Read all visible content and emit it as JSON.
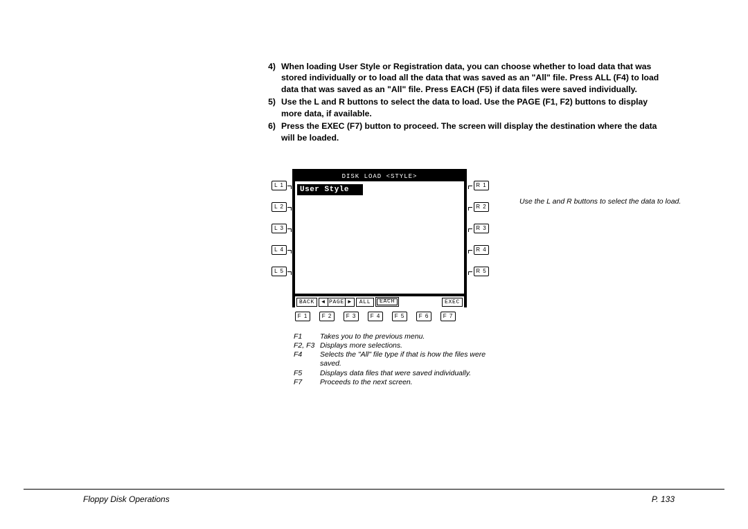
{
  "steps": [
    {
      "n": "4)",
      "text": "When loading User Style or Registration data, you can choose whether to load data that was stored individually or to load all the data that was saved as an \"All\" file.  Press ALL (F4) to load data that was saved as an \"All\" file.  Press EACH (F5) if data files were saved individually."
    },
    {
      "n": "5)",
      "text": "Use the L and R buttons to select the data to load.  Use the PAGE (F1, F2) buttons to display more data, if available."
    },
    {
      "n": "6)",
      "text": "Press the EXEC (F7) button to proceed.  The screen will display the destination where the data will be loaded."
    }
  ],
  "lcd": {
    "title": "DISK LOAD <STYLE>",
    "item": "User Style",
    "softkeys": {
      "back": "BACK",
      "page": "PAGE",
      "all": "ALL",
      "each": "EACH",
      "exec": "EXEC",
      "left": "◄",
      "right": "►"
    }
  },
  "side_buttons": {
    "L": [
      "L 1",
      "L 2",
      "L 3",
      "L 4",
      "L 5"
    ],
    "R": [
      "R 1",
      "R 2",
      "R 3",
      "R 4",
      "R 5"
    ]
  },
  "fkeys": [
    "F 1",
    "F 2",
    "F 3",
    "F 4",
    "F 5",
    "F 6",
    "F 7"
  ],
  "side_caption": "Use the L and R buttons to select the data to load.",
  "legend": [
    {
      "k": "F1",
      "t": "Takes you to the previous menu."
    },
    {
      "k": "F2, F3",
      "t": "Displays more selections."
    },
    {
      "k": "F4",
      "t": "Selects the \"All\" file type if that is how the files were saved."
    },
    {
      "k": "F5",
      "t": "Displays data files that were saved individually."
    },
    {
      "k": "F7",
      "t": "Proceeds to the next screen."
    }
  ],
  "footer": {
    "left": "Floppy Disk Operations",
    "right": "P. 133"
  }
}
